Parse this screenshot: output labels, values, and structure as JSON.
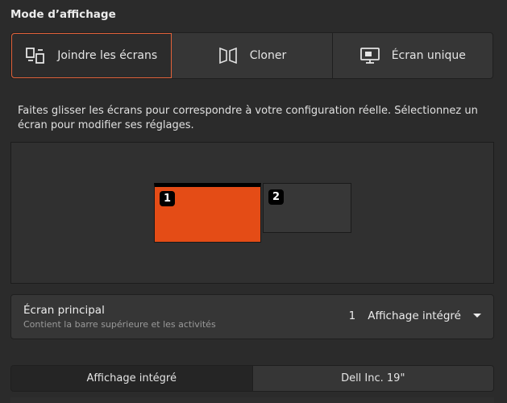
{
  "display_mode": {
    "title": "Mode d’affichage",
    "options": [
      {
        "label": "Joindre les écrans",
        "icon": "join-displays-icon",
        "active": true
      },
      {
        "label": "Cloner",
        "icon": "mirror-icon",
        "active": false
      },
      {
        "label": "Écran unique",
        "icon": "single-display-icon",
        "active": false
      }
    ]
  },
  "arrangement": {
    "hint": "Faites glisser les écrans pour correspondre à votre configuration réelle. Sélectionnez un écran pour modifier ses réglages.",
    "monitors": [
      {
        "number": "1",
        "color": "#e44c16",
        "selected": true
      },
      {
        "number": "2",
        "color": "#373737",
        "selected": false
      }
    ]
  },
  "primary_display": {
    "title": "Écran principal",
    "subtitle": "Contient la barre supérieure et les activités",
    "number": "1",
    "value": "Affichage intégré"
  },
  "tabs": [
    {
      "label": "Affichage intégré",
      "active": true
    },
    {
      "label": "Dell Inc. 19\"",
      "active": false
    }
  ],
  "colors": {
    "accent": "#e2623a",
    "selected_monitor": "#e44c16",
    "background": "#2b2b2b"
  }
}
